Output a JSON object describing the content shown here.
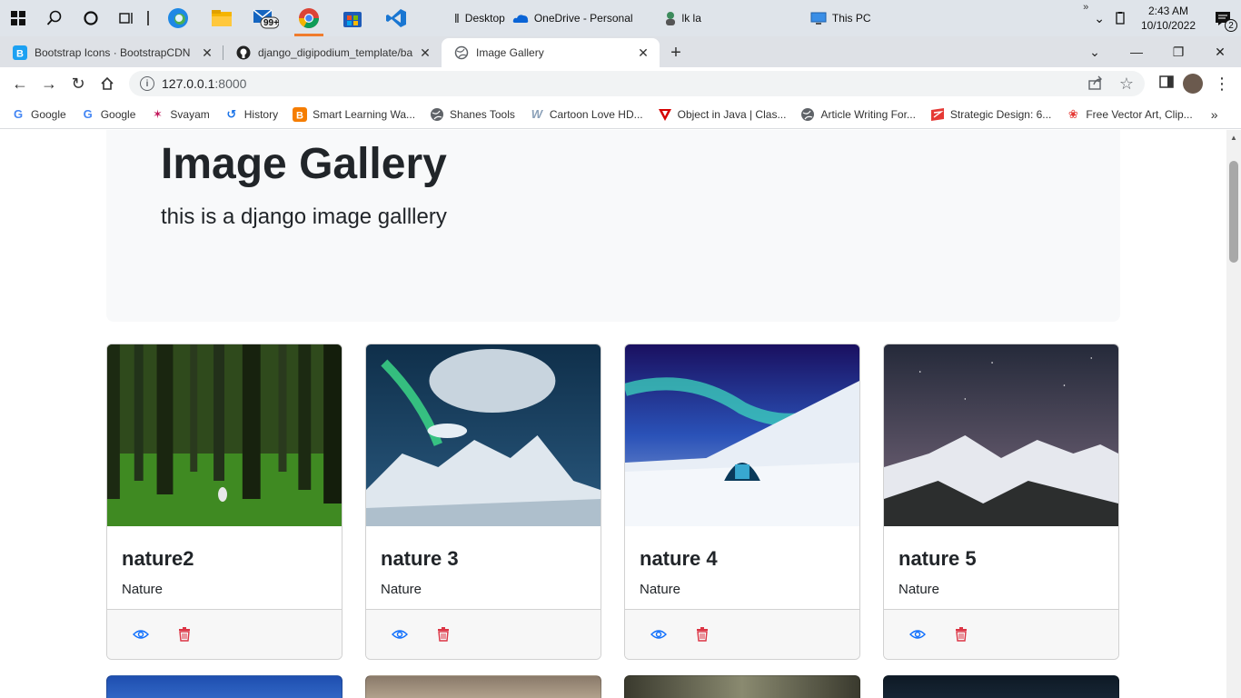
{
  "taskbar": {
    "mail_badge": "99+",
    "desktop_label": "Desktop",
    "onedrive_label": "OneDrive - Personal",
    "user_label": "lk la",
    "thispc_label": "This PC",
    "time": "2:43 AM",
    "date": "10/10/2022",
    "notification_count": "2"
  },
  "tabs": [
    {
      "title": "Bootstrap Icons · BootstrapCDN",
      "favicon": "bootstrap-icon"
    },
    {
      "title": "django_digipodium_template/ba",
      "favicon": "github-icon"
    },
    {
      "title": "Image Gallery",
      "favicon": "globe-icon"
    }
  ],
  "address": {
    "host": "127.0.0.1",
    "port": ":8000"
  },
  "bookmarks": [
    {
      "label": "Google",
      "icon": "google-icon"
    },
    {
      "label": "Google",
      "icon": "google-icon"
    },
    {
      "label": "Svayam",
      "icon": "svayam-icon"
    },
    {
      "label": "History",
      "icon": "history-icon"
    },
    {
      "label": "Smart Learning Wa...",
      "icon": "blogger-icon"
    },
    {
      "label": "Shanes Tools",
      "icon": "globe-icon"
    },
    {
      "label": "Cartoon Love HD...",
      "icon": "w-icon"
    },
    {
      "label": "Object in Java | Clas...",
      "icon": "triangle-icon"
    },
    {
      "label": "Article Writing For...",
      "icon": "globe-icon"
    },
    {
      "label": "Strategic Design: 6...",
      "icon": "flag-icon"
    },
    {
      "label": "Free Vector Art, Clip...",
      "icon": "vector-icon"
    }
  ],
  "page": {
    "heading": "Image Gallery",
    "subheading": "this is a django image galllery"
  },
  "cards": [
    {
      "title": "nature2",
      "category": "Nature"
    },
    {
      "title": "nature 3",
      "category": "Nature"
    },
    {
      "title": "nature 4",
      "category": "Nature"
    },
    {
      "title": "nature 5",
      "category": "Nature"
    }
  ],
  "colors": {
    "view_icon": "#0d6efd",
    "delete_icon": "#dc3545"
  }
}
